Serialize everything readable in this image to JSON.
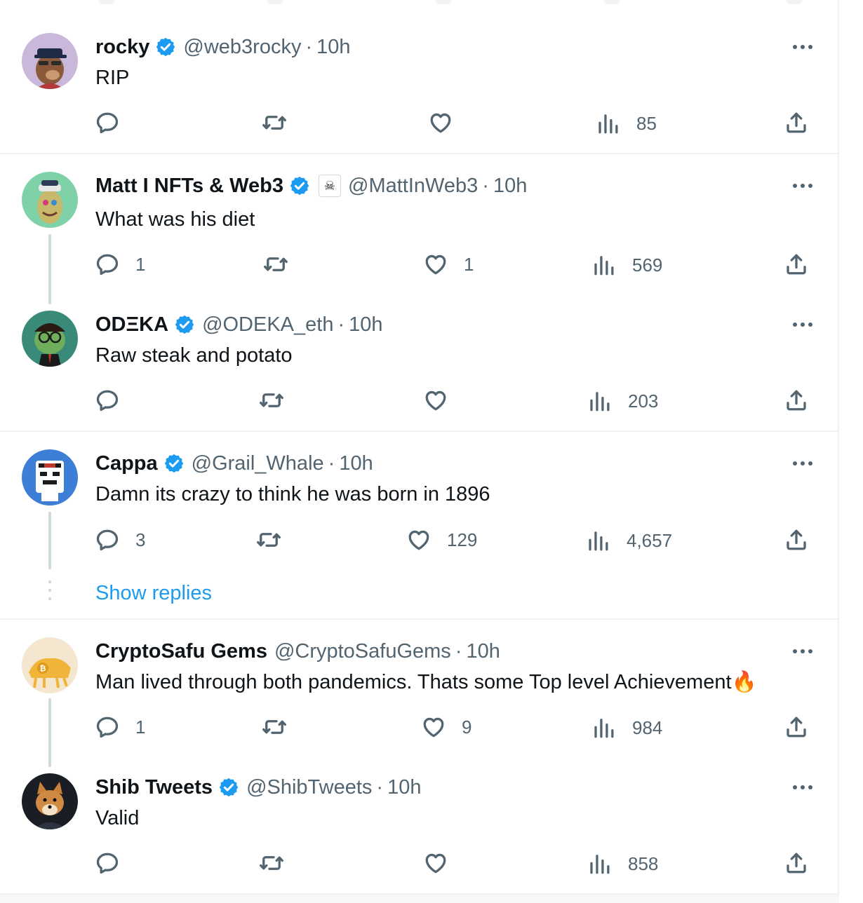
{
  "colors": {
    "accent": "#1d9bf0",
    "secondary_text": "#536471",
    "divider": "#eff3f4"
  },
  "tweets": [
    {
      "avatar_icon": "bear-avatar-icon",
      "name": "rocky",
      "verified": true,
      "handle": "@web3rocky",
      "separator": "·",
      "time": "10h",
      "text": "RIP",
      "replies": "",
      "likes": "",
      "views": "85"
    },
    {
      "avatar_icon": "ape-avatar-icon",
      "name": "Matt I NFTs & Web3",
      "verified": true,
      "affiliate_icon": "skull-badge-icon",
      "handle": "@MattInWeb3",
      "separator": "·",
      "time": "10h",
      "text": "What was his diet",
      "replies": "1",
      "likes": "1",
      "views": "569"
    },
    {
      "avatar_icon": "frog-avatar-icon",
      "name": "ODΞKA",
      "verified": true,
      "handle": "@ODEKA_eth",
      "separator": "·",
      "time": "10h",
      "text": "Raw steak and potato",
      "replies": "",
      "likes": "",
      "views": "203"
    },
    {
      "avatar_icon": "robot-avatar-icon",
      "name": "Cappa",
      "verified": true,
      "handle": "@Grail_Whale",
      "separator": "·",
      "time": "10h",
      "text": "Damn its crazy to think he was born in 1896",
      "replies": "3",
      "likes": "129",
      "views": "4,657"
    },
    {
      "avatar_icon": "bull-avatar-icon",
      "name": "CryptoSafu Gems",
      "verified": false,
      "handle": "@CryptoSafuGems",
      "separator": "·",
      "time": "10h",
      "text": "Man lived through both pandemics. Thats some Top level Achievement🔥",
      "replies": "1",
      "likes": "9",
      "views": "984"
    },
    {
      "avatar_icon": "shiba-avatar-icon",
      "name": "Shib Tweets",
      "verified": true,
      "handle": "@ShibTweets",
      "separator": "·",
      "time": "10h",
      "text": "Valid",
      "replies": "",
      "likes": "",
      "views": "858"
    }
  ],
  "show_replies": "Show replies",
  "action_icons": [
    "reply-icon",
    "retweet-icon",
    "like-icon",
    "views-icon",
    "share-icon"
  ]
}
